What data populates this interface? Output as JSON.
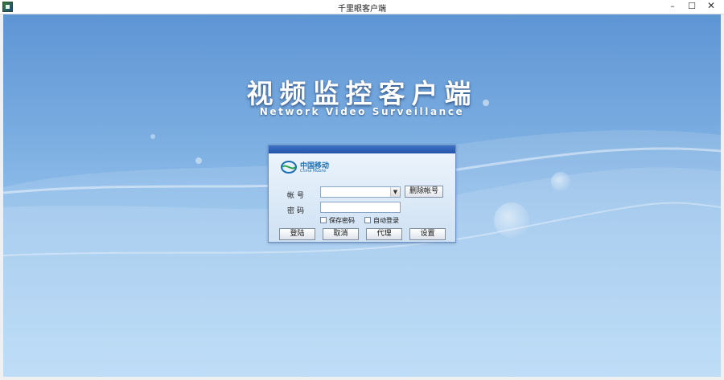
{
  "window": {
    "title": "千里眼客户端",
    "minimize_glyph": "–",
    "maximize_glyph": "☐",
    "close_glyph": "✕"
  },
  "banner": {
    "title_cn": "视频监控客户端",
    "title_en": "Network Video Surveillance"
  },
  "login": {
    "logo_cn": "中国移动",
    "logo_en": "China Mobile",
    "account_label": "帐号",
    "account_value": "",
    "password_label": "密码",
    "password_value": "",
    "delete_account_label": "删除帐号",
    "remember_password_label": "保存密码",
    "auto_login_label": "自动登录",
    "remember_password_checked": false,
    "auto_login_checked": false,
    "buttons": {
      "login": "登陆",
      "cancel": "取消",
      "proxy": "代理",
      "settings": "设置"
    }
  },
  "icons": {
    "app": "app-icon",
    "dropdown": "chevron-down-icon",
    "logo": "china-mobile-logo"
  },
  "colors": {
    "panel_bar": "#2353a8",
    "background_top": "#5e95d4",
    "background_bottom": "#acd4f5"
  }
}
